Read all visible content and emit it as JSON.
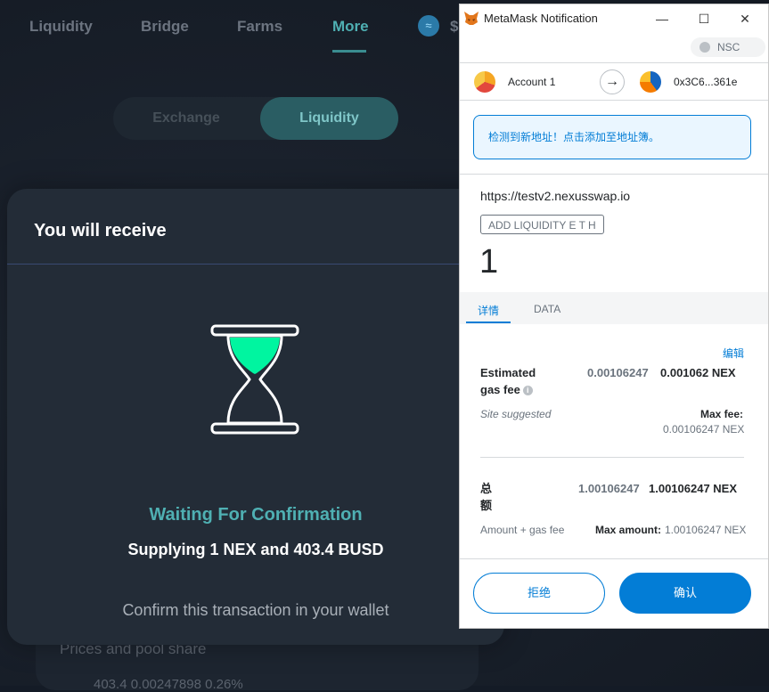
{
  "dapp": {
    "nav": [
      "Liquidity",
      "Bridge",
      "Farms",
      "More"
    ],
    "nav_active": "More",
    "nav_partial": "$",
    "toggle": {
      "exchange": "Exchange",
      "liquidity": "Liquidity"
    },
    "card_label": "Prices and pool share",
    "card_values": "403.4        0.00247898        0.26%"
  },
  "modal": {
    "title": "You will receive",
    "waiting_title": "Waiting For Confirmation",
    "waiting_sub": "Supplying 1 NEX and 403.4 BUSD",
    "confirm_text": "Confirm this transaction in your wallet",
    "accent_color": "#4fb0b3",
    "hourglass_fill": "#00f5a0"
  },
  "metamask": {
    "window_title": "MetaMask Notification",
    "network": "NSC",
    "from_account": "Account 1",
    "to_address": "0x3C6...361e",
    "notice": "检测到新地址！点击添加至地址簿。",
    "origin": "https://testv2.nexusswap.io",
    "method": "ADD LIQUIDITY E T H",
    "amount": "1",
    "tabs": {
      "details": "详情",
      "data": "DATA"
    },
    "edit": "编辑",
    "gas_label_1": "Estimated",
    "gas_label_2": "gas fee",
    "gas_fee_fiat": "0.00106247",
    "gas_fee": "0.001062 NEX",
    "site_suggested": "Site suggested",
    "max_fee_label": "Max fee:",
    "max_fee_value": "0.00106247 NEX",
    "total_label_1": "总",
    "total_label_2": "额",
    "total_fiat": "1.00106247",
    "total": "1.00106247 NEX",
    "amount_plus_gas": "Amount + gas fee",
    "max_amount_label": "Max amount:",
    "max_amount_value": "1.00106247 NEX",
    "reject": "拒绝",
    "confirm": "确认",
    "brand_color": "#037dd6"
  }
}
